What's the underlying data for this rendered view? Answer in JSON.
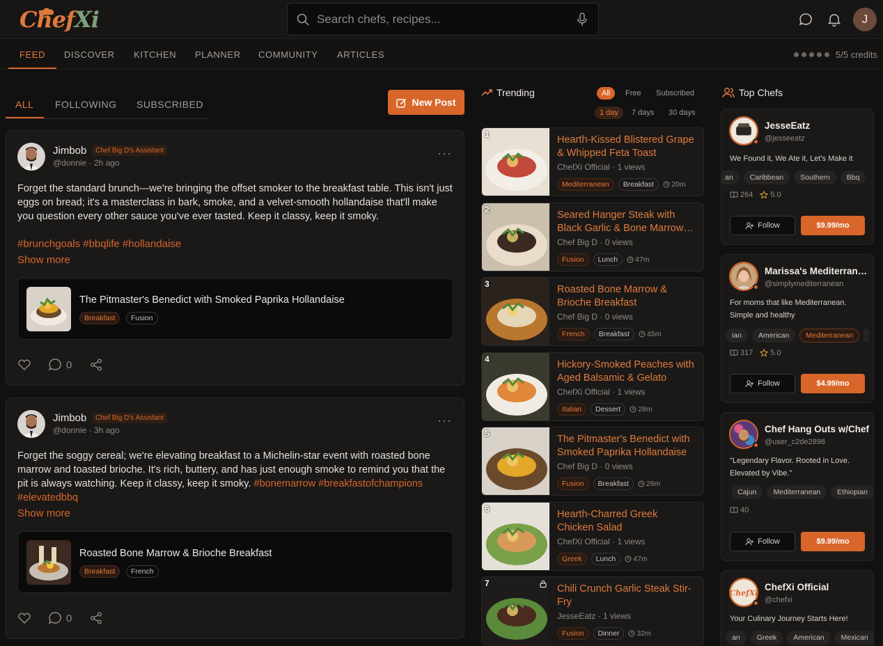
{
  "brand": {
    "logo_part1": "Chef",
    "logo_part2": "Xi"
  },
  "search": {
    "placeholder": "Search chefs, recipes..."
  },
  "user": {
    "initial": "J"
  },
  "nav": {
    "tabs": [
      "FEED",
      "DISCOVER",
      "KITCHEN",
      "PLANNER",
      "COMMUNITY",
      "ARTICLES"
    ],
    "active": "FEED",
    "credits": "5/5 credits"
  },
  "feed": {
    "tabs": [
      "ALL",
      "FOLLOWING",
      "SUBSCRIBED"
    ],
    "new_post": "New Post",
    "show_more": "Show more",
    "posts": [
      {
        "author": "Jimbob",
        "badge": "Chef Big D's Assistant",
        "handle": "@donnie",
        "time": "2h ago",
        "text": "Forget the standard brunch—we're bringing the offset smoker to the breakfast table. This isn't just eggs on bread; it's a masterclass in bark, smoke, and a velvet-smooth hollandaise that'll make you question every other sauce you've ever tasted. Keep it classy, keep it smoky.",
        "hashtags": "#brunchgoals #bbqlife #hollandaise",
        "recipe": {
          "title": "The Pitmaster's Benedict with Smoked Paprika Hollandaise",
          "tags": [
            "Breakfast",
            "Fusion"
          ]
        },
        "comments": "0"
      },
      {
        "author": "Jimbob",
        "badge": "Chef Big D's Assistant",
        "handle": "@donnie",
        "time": "3h ago",
        "text": "Forget the soggy cereal; we're elevating breakfast to a Michelin-star event with roasted bone marrow and toasted brioche. It's rich, buttery, and has just enough smoke to remind you that the pit is always watching. Keep it classy, keep it smoky.",
        "hashtags": "#bonemarrow #breakfastofchampions #elevatedbbq",
        "recipe": {
          "title": "Roasted Bone Marrow & Brioche Breakfast",
          "tags": [
            "Breakfast",
            "French"
          ]
        },
        "comments": "0"
      }
    ]
  },
  "trending": {
    "title": "Trending",
    "filters": [
      "All",
      "Free",
      "Subscribed"
    ],
    "ranges": [
      "1 day",
      "7 days",
      "30 days"
    ],
    "items": [
      {
        "rank": "1",
        "title": "Hearth-Kissed Blistered Grape & Whipped Feta Toast",
        "meta": "ChefXi Official · 1 views",
        "tag1": "Mediterranean",
        "tag2": "Breakfast",
        "dur": "20m"
      },
      {
        "rank": "2",
        "title": "Seared Hanger Steak with Black Garlic & Bone Marrow…",
        "meta": "Chef Big D · 0 views",
        "tag1": "Fusion",
        "tag2": "Lunch",
        "dur": "47m"
      },
      {
        "rank": "3",
        "title": "Roasted Bone Marrow & Brioche Breakfast",
        "meta": "Chef Big D · 0 views",
        "tag1": "French",
        "tag2": "Breakfast",
        "dur": "45m"
      },
      {
        "rank": "4",
        "title": "Hickory-Smoked Peaches with Aged Balsamic & Gelato",
        "meta": "ChefXi Official · 1 views",
        "tag1": "Italian",
        "tag2": "Dessert",
        "dur": "28m"
      },
      {
        "rank": "5",
        "title": "The Pitmaster's Benedict with Smoked Paprika Hollandaise",
        "meta": "Chef Big D · 0 views",
        "tag1": "Fusion",
        "tag2": "Breakfast",
        "dur": "26m"
      },
      {
        "rank": "6",
        "title": "Hearth-Charred Greek Chicken Salad",
        "meta": "ChefXi Official · 1 views",
        "tag1": "Greek",
        "tag2": "Lunch",
        "dur": "47m"
      },
      {
        "rank": "7",
        "title": "Chili Crunch Garlic Steak Stir-Fry",
        "meta": "JesseEatz · 1 views",
        "tag1": "Fusion",
        "tag2": "Dinner",
        "dur": "32m"
      }
    ]
  },
  "top_chefs": {
    "title": "Top Chefs",
    "follow_label": "Follow",
    "chefs": [
      {
        "name": "JesseEatz",
        "handle": "@jesseeatz",
        "bio": "We Found it, We Ate it, Let's Make it",
        "tags": [
          "an",
          "Caribbean",
          "Southern",
          "Bbq"
        ],
        "recipes": "264",
        "rating": "5.0",
        "price": "$9.99/mo"
      },
      {
        "name": "Marissa's Mediterranean",
        "handle": "@simplymediterranean",
        "bio": "For moms that like Mediterranean. Simple and healthy",
        "tags": [
          "ian",
          "American",
          "Mediterranean",
          ""
        ],
        "recipes": "317",
        "rating": "5.0",
        "price": "$4.99/mo"
      },
      {
        "name": "Chef Hang Outs w/Chef Bis",
        "handle": "@user_c2de2898",
        "bio": "\"Legendary Flavor. Rooted in Love. Elevated by Vibe.\"",
        "tags": [
          "Cajun",
          "Mediterranean",
          "Ethiopian"
        ],
        "recipes": "40",
        "price": "$9.99/mo"
      },
      {
        "name": "ChefXi Official",
        "handle": "@chefxi",
        "bio": "Your Culinary Journey Starts Here!",
        "tags": [
          "an",
          "Greek",
          "American",
          "Mexican"
        ]
      }
    ]
  },
  "colors": {
    "accent": "#d8662a",
    "background": "#121111",
    "card": "#1a1918"
  }
}
